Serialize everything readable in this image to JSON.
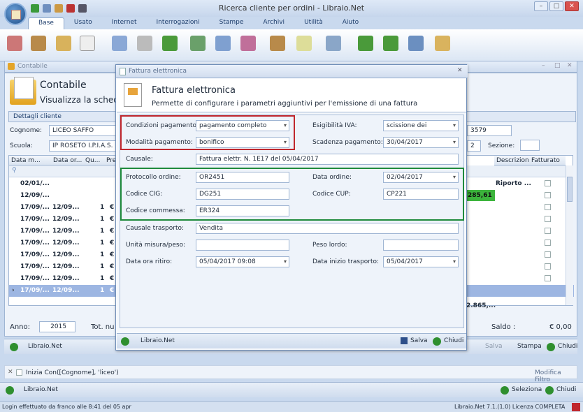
{
  "app": {
    "title": "Ricerca cliente per ordini - Libraio.Net"
  },
  "ribbon_tabs": [
    "Base",
    "Usato",
    "Internet",
    "Interrogazioni",
    "Stampe",
    "Archivi",
    "Utilità",
    "Aiuto"
  ],
  "window": {
    "title": "Contabile",
    "heading": "Contabile",
    "subtitle": "Visualizza la scheda"
  },
  "client": {
    "section": "Dettagli cliente",
    "cognome_label": "Cognome:",
    "cognome": "LICEO SAFFO",
    "scuola_label": "Scuola:",
    "scuola": "IP ROSETO I.P.I.A.S.",
    "code": "3579",
    "code2": "2",
    "sezione_label": "Sezione:"
  },
  "grid": {
    "headers": [
      "Data m...",
      "Data or...",
      "Qu...",
      "Pre"
    ],
    "right_headers": [
      "Descrizione",
      "Fatturato"
    ],
    "rows": [
      {
        "c1": "02/01/...",
        "c2": "",
        "c3": "",
        "c4": ""
      },
      {
        "c1": "12/09/...",
        "c2": "",
        "c3": "",
        "c4": ""
      },
      {
        "c1": "17/09/...",
        "c2": "12/09...",
        "c3": "1",
        "c4": "€"
      },
      {
        "c1": "17/09/...",
        "c2": "12/09...",
        "c3": "1",
        "c4": "€"
      },
      {
        "c1": "17/09/...",
        "c2": "12/09...",
        "c3": "1",
        "c4": "€"
      },
      {
        "c1": "17/09/...",
        "c2": "12/09...",
        "c3": "1",
        "c4": "€"
      },
      {
        "c1": "17/09/...",
        "c2": "12/09...",
        "c3": "1",
        "c4": "€"
      },
      {
        "c1": "17/09/...",
        "c2": "12/09...",
        "c3": "1",
        "c4": "€"
      },
      {
        "c1": "17/09/...",
        "c2": "12/09...",
        "c3": "1",
        "c4": "€"
      },
      {
        "c1": "17/09/...",
        "c2": "12/09...",
        "c3": "1",
        "c4": "€"
      }
    ],
    "riporto": "Riporto ...",
    "green_value": "285,61",
    "total_value": "2.865,..."
  },
  "footer": {
    "anno_label": "Anno:",
    "anno": "2015",
    "tot_label": "Tot. nu",
    "saldo_label": "Saldo :",
    "saldo": "€ 0,00",
    "brand": "Libraio.Net",
    "salva": "Salva",
    "stampa": "Stampa",
    "chiudi": "Chiudi"
  },
  "filter": {
    "text": "Inizia Con([Cognome], 'liceo')",
    "modifica": "Modifica Filtro"
  },
  "bottom": {
    "brand": "Libraio.Net",
    "seleziona": "Seleziona",
    "chiudi": "Chiudi"
  },
  "status": {
    "left": "Login effettuato da franco alle 8:41 del 05 apr",
    "right": "Libraio.Net 7.1.(1.0) Licenza COMPLETA"
  },
  "dialog": {
    "title": "Fattura elettronica",
    "heading": "Fattura elettronica",
    "subtitle": "Permette di configurare i parametri aggiuntivi per l'emissione di una fattura",
    "cond_label": "Condizioni pagamento:",
    "cond": "pagamento completo",
    "mod_label": "Modalità pagamento:",
    "mod": "bonifico",
    "esig_label": "Esigibilità IVA:",
    "esig": "scissione dei pagamenti",
    "scad_label": "Scadenza pagamento:",
    "scad": "30/04/2017",
    "causale_label": "Causale:",
    "causale": "Fattura elettr. N. 1E17 del 05/04/2017",
    "prot_label": "Protocollo ordine:",
    "prot": "OR2451",
    "dataord_label": "Data ordine:",
    "dataord": "02/04/2017",
    "cig_label": "Codice CIG:",
    "cig": "DG251",
    "cup_label": "Codice CUP:",
    "cup": "CP221",
    "comm_label": "Codice commessa:",
    "comm": "ER324",
    "trasp_label": "Causale trasporto:",
    "trasp": "Vendita",
    "unita_label": "Unità misura/peso:",
    "unita": "",
    "peso_label": "Peso lordo:",
    "peso": "",
    "ritiro_label": "Data ora ritiro:",
    "ritiro": "05/04/2017 09:08",
    "inizio_label": "Data inizio trasporto:",
    "inizio": "05/04/2017",
    "brand": "Libraio.Net",
    "salva": "Salva",
    "chiudi": "Chiudi"
  }
}
